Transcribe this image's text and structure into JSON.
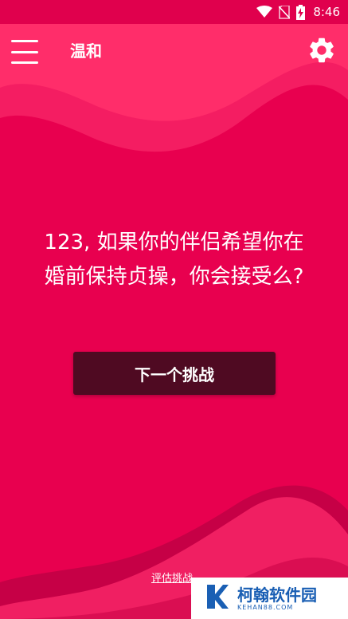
{
  "status_bar": {
    "time": "8:46"
  },
  "appbar": {
    "title": "温和"
  },
  "question": {
    "line1": "123, 如果你的伴侣希望你在",
    "line2": "婚前保持贞操，你会接受么?"
  },
  "actions": {
    "next_label": "下一个挑战",
    "rate_label": "评估挑战"
  },
  "watermark": {
    "main": "柯翰软件园",
    "sub": "KEHAN88.COM"
  },
  "colors": {
    "background": "#e8004f",
    "button": "#4f0a22",
    "wave_light": "#ff2d6a",
    "wave_dark": "#c80045"
  },
  "icons": [
    "wifi-icon",
    "no-sim-icon",
    "battery-charging-icon",
    "menu-icon",
    "gear-icon",
    "watermark-logo-icon"
  ]
}
